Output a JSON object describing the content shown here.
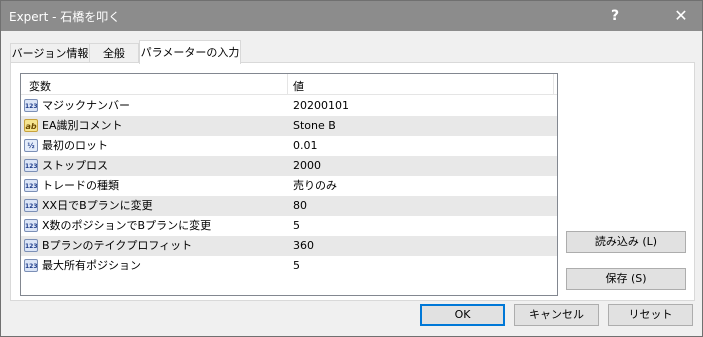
{
  "window": {
    "title": "Expert - 石橋を叩く",
    "help_label": "?",
    "close_label": "✕"
  },
  "tabs": [
    {
      "label": "バージョン情報"
    },
    {
      "label": "全般"
    },
    {
      "label": "パラメーターの入力"
    }
  ],
  "active_tab": "パラメーターの入力",
  "grid": {
    "columns": [
      "変数",
      "値"
    ],
    "rows": [
      {
        "icon": "123-integer-icon",
        "icon_text": "123",
        "name": "マジックナンバー",
        "value": "20200101"
      },
      {
        "icon": "ab-string-icon",
        "icon_text": "ab",
        "name": "EA識別コメント",
        "value": "Stone B"
      },
      {
        "icon": "fraction-double-icon",
        "icon_text": "½",
        "name": "最初のロット",
        "value": "0.01"
      },
      {
        "icon": "123-integer-icon",
        "icon_text": "123",
        "name": "ストップロス",
        "value": "2000"
      },
      {
        "icon": "123-integer-icon",
        "icon_text": "123",
        "name": "トレードの種類",
        "value": "売りのみ"
      },
      {
        "icon": "123-integer-icon",
        "icon_text": "123",
        "name": "XX日でBプランに変更",
        "value": "80"
      },
      {
        "icon": "123-integer-icon",
        "icon_text": "123",
        "name": "X数のポジションでBプランに変更",
        "value": "5"
      },
      {
        "icon": "123-integer-icon",
        "icon_text": "123",
        "name": "Bプランのテイクプロフィット",
        "value": "360"
      },
      {
        "icon": "123-integer-icon",
        "icon_text": "123",
        "name": "最大所有ポジション",
        "value": "5"
      }
    ]
  },
  "buttons": {
    "load": "読み込み (L)",
    "save": "保存 (S)",
    "ok": "OK",
    "cancel": "キャンセル",
    "reset": "リセット"
  }
}
